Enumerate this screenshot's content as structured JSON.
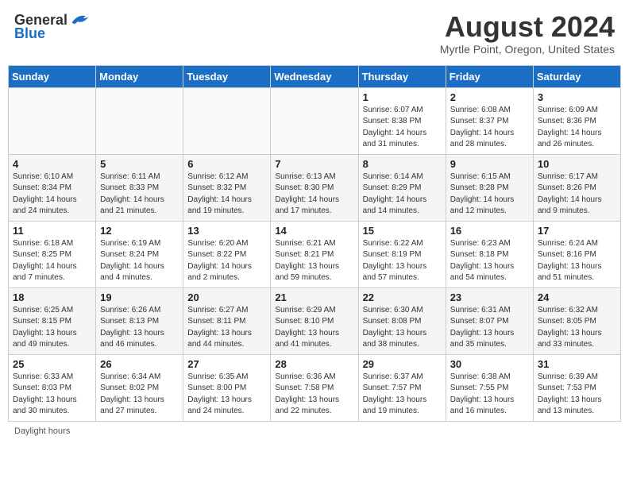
{
  "header": {
    "logo_general": "General",
    "logo_blue": "Blue",
    "title": "August 2024",
    "subtitle": "Myrtle Point, Oregon, United States"
  },
  "days_of_week": [
    "Sunday",
    "Monday",
    "Tuesday",
    "Wednesday",
    "Thursday",
    "Friday",
    "Saturday"
  ],
  "weeks": [
    [
      {
        "day": "",
        "info": ""
      },
      {
        "day": "",
        "info": ""
      },
      {
        "day": "",
        "info": ""
      },
      {
        "day": "",
        "info": ""
      },
      {
        "day": "1",
        "info": "Sunrise: 6:07 AM\nSunset: 8:38 PM\nDaylight: 14 hours and 31 minutes."
      },
      {
        "day": "2",
        "info": "Sunrise: 6:08 AM\nSunset: 8:37 PM\nDaylight: 14 hours and 28 minutes."
      },
      {
        "day": "3",
        "info": "Sunrise: 6:09 AM\nSunset: 8:36 PM\nDaylight: 14 hours and 26 minutes."
      }
    ],
    [
      {
        "day": "4",
        "info": "Sunrise: 6:10 AM\nSunset: 8:34 PM\nDaylight: 14 hours and 24 minutes."
      },
      {
        "day": "5",
        "info": "Sunrise: 6:11 AM\nSunset: 8:33 PM\nDaylight: 14 hours and 21 minutes."
      },
      {
        "day": "6",
        "info": "Sunrise: 6:12 AM\nSunset: 8:32 PM\nDaylight: 14 hours and 19 minutes."
      },
      {
        "day": "7",
        "info": "Sunrise: 6:13 AM\nSunset: 8:30 PM\nDaylight: 14 hours and 17 minutes."
      },
      {
        "day": "8",
        "info": "Sunrise: 6:14 AM\nSunset: 8:29 PM\nDaylight: 14 hours and 14 minutes."
      },
      {
        "day": "9",
        "info": "Sunrise: 6:15 AM\nSunset: 8:28 PM\nDaylight: 14 hours and 12 minutes."
      },
      {
        "day": "10",
        "info": "Sunrise: 6:17 AM\nSunset: 8:26 PM\nDaylight: 14 hours and 9 minutes."
      }
    ],
    [
      {
        "day": "11",
        "info": "Sunrise: 6:18 AM\nSunset: 8:25 PM\nDaylight: 14 hours and 7 minutes."
      },
      {
        "day": "12",
        "info": "Sunrise: 6:19 AM\nSunset: 8:24 PM\nDaylight: 14 hours and 4 minutes."
      },
      {
        "day": "13",
        "info": "Sunrise: 6:20 AM\nSunset: 8:22 PM\nDaylight: 14 hours and 2 minutes."
      },
      {
        "day": "14",
        "info": "Sunrise: 6:21 AM\nSunset: 8:21 PM\nDaylight: 13 hours and 59 minutes."
      },
      {
        "day": "15",
        "info": "Sunrise: 6:22 AM\nSunset: 8:19 PM\nDaylight: 13 hours and 57 minutes."
      },
      {
        "day": "16",
        "info": "Sunrise: 6:23 AM\nSunset: 8:18 PM\nDaylight: 13 hours and 54 minutes."
      },
      {
        "day": "17",
        "info": "Sunrise: 6:24 AM\nSunset: 8:16 PM\nDaylight: 13 hours and 51 minutes."
      }
    ],
    [
      {
        "day": "18",
        "info": "Sunrise: 6:25 AM\nSunset: 8:15 PM\nDaylight: 13 hours and 49 minutes."
      },
      {
        "day": "19",
        "info": "Sunrise: 6:26 AM\nSunset: 8:13 PM\nDaylight: 13 hours and 46 minutes."
      },
      {
        "day": "20",
        "info": "Sunrise: 6:27 AM\nSunset: 8:11 PM\nDaylight: 13 hours and 44 minutes."
      },
      {
        "day": "21",
        "info": "Sunrise: 6:29 AM\nSunset: 8:10 PM\nDaylight: 13 hours and 41 minutes."
      },
      {
        "day": "22",
        "info": "Sunrise: 6:30 AM\nSunset: 8:08 PM\nDaylight: 13 hours and 38 minutes."
      },
      {
        "day": "23",
        "info": "Sunrise: 6:31 AM\nSunset: 8:07 PM\nDaylight: 13 hours and 35 minutes."
      },
      {
        "day": "24",
        "info": "Sunrise: 6:32 AM\nSunset: 8:05 PM\nDaylight: 13 hours and 33 minutes."
      }
    ],
    [
      {
        "day": "25",
        "info": "Sunrise: 6:33 AM\nSunset: 8:03 PM\nDaylight: 13 hours and 30 minutes."
      },
      {
        "day": "26",
        "info": "Sunrise: 6:34 AM\nSunset: 8:02 PM\nDaylight: 13 hours and 27 minutes."
      },
      {
        "day": "27",
        "info": "Sunrise: 6:35 AM\nSunset: 8:00 PM\nDaylight: 13 hours and 24 minutes."
      },
      {
        "day": "28",
        "info": "Sunrise: 6:36 AM\nSunset: 7:58 PM\nDaylight: 13 hours and 22 minutes."
      },
      {
        "day": "29",
        "info": "Sunrise: 6:37 AM\nSunset: 7:57 PM\nDaylight: 13 hours and 19 minutes."
      },
      {
        "day": "30",
        "info": "Sunrise: 6:38 AM\nSunset: 7:55 PM\nDaylight: 13 hours and 16 minutes."
      },
      {
        "day": "31",
        "info": "Sunrise: 6:39 AM\nSunset: 7:53 PM\nDaylight: 13 hours and 13 minutes."
      }
    ]
  ],
  "footer": {
    "note": "Daylight hours"
  }
}
